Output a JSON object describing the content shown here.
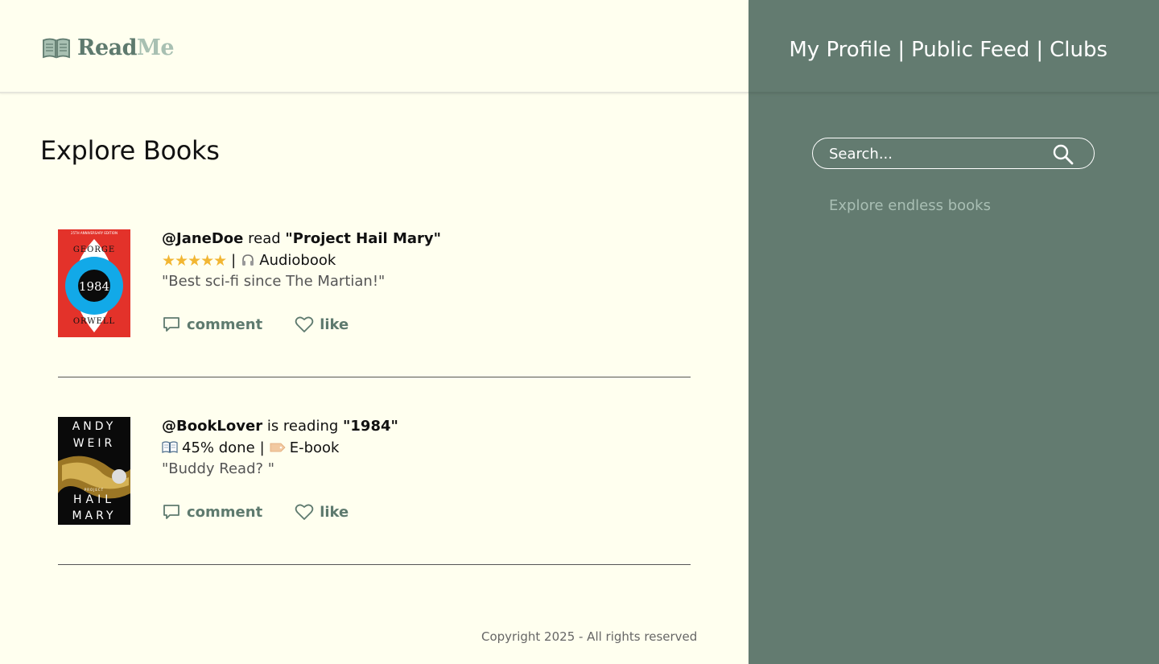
{
  "brand": {
    "logo_icon": "open-book-icon",
    "name_part1": "Read",
    "name_part2": "Me",
    "color_primary": "#5e7a6e",
    "color_secondary": "#a8c0b2"
  },
  "nav": {
    "items": [
      {
        "label": "My Profile"
      },
      {
        "label": "Public Feed"
      },
      {
        "label": "Clubs"
      }
    ],
    "separator": "|"
  },
  "page": {
    "title": "Explore Books"
  },
  "search": {
    "placeholder": "Search...",
    "icon": "search-icon",
    "tagline": "Explore endless books"
  },
  "posts": [
    {
      "user": "@JaneDoe",
      "verb": "read",
      "book_title": "\"Project Hail Mary\"",
      "rating": 5,
      "stars": "★★★★★",
      "format_icon": "headphones-icon",
      "format": "Audiobook",
      "quote": "\"Best sci-fi since The Martian!\"",
      "cover": {
        "top_text": "25TH ANNIVERSARY EDITION",
        "author_first": "GEORGE",
        "author_last": "ORWELL",
        "title": "1984"
      },
      "comment_label": "comment",
      "like_label": "like"
    },
    {
      "user": "@BookLover",
      "verb": "is reading",
      "book_title": "\"1984\"",
      "progress_icon": "open-book-icon",
      "progress": "45% done",
      "format_icon": "tag-icon",
      "format": "E-book",
      "quote": "\"Buddy Read? \"",
      "cover": {
        "author_first": "ANDY",
        "author_last": "WEIR",
        "title_line1": "PROJECT",
        "title_line2": "HAIL",
        "title_line3": "MARY"
      },
      "comment_label": "comment",
      "like_label": "like"
    }
  ],
  "footer": {
    "copyright": "Copyright 2025 - All rights reserved"
  },
  "colors": {
    "background": "#ffffef",
    "sidebar": "#637b70",
    "accent": "#5e7a6e",
    "star": "#f2b632"
  }
}
